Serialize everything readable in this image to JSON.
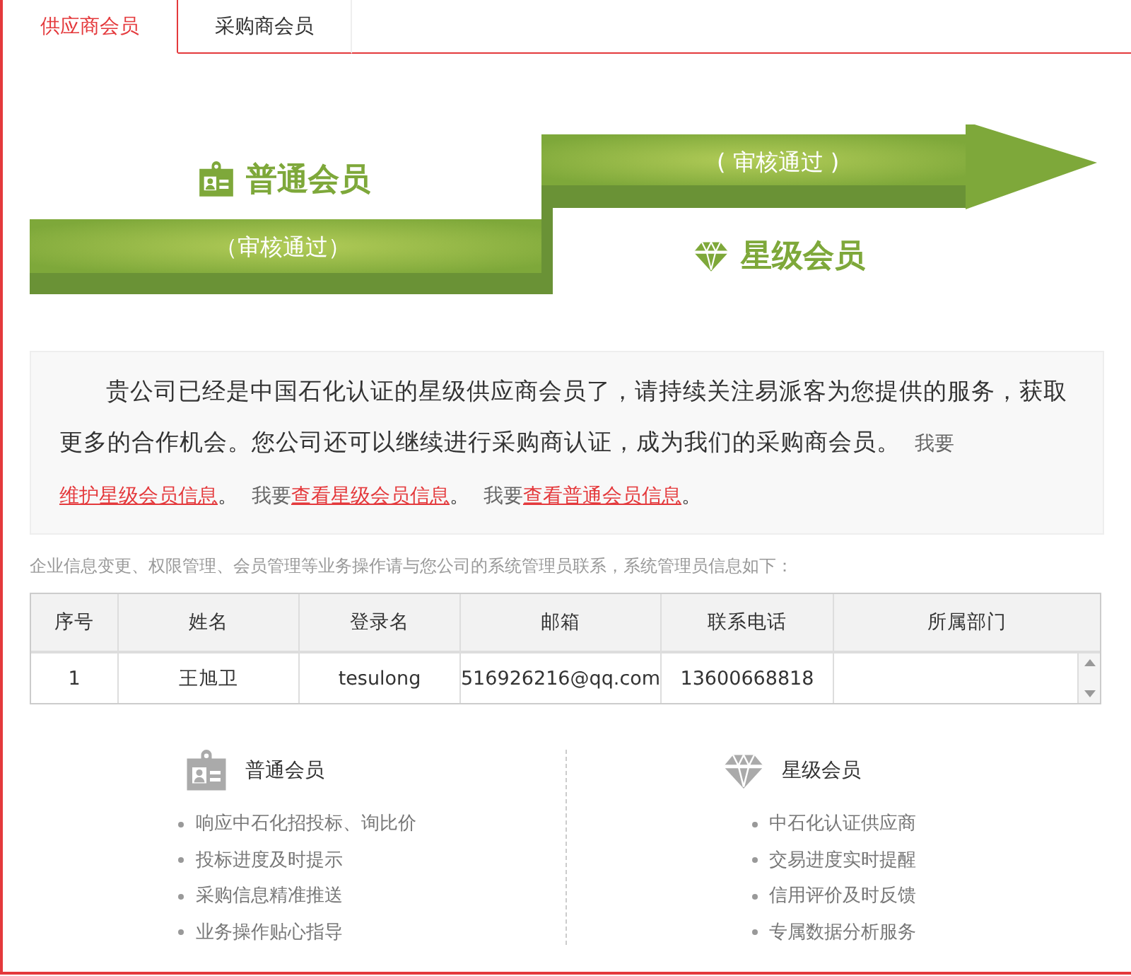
{
  "tabs": [
    {
      "label": "供应商会员",
      "selected": true
    },
    {
      "label": "采购商会员",
      "selected": false
    }
  ],
  "progress": {
    "basic": {
      "title": "普通会员",
      "status": "（审核通过）"
    },
    "star": {
      "title": "星级会员",
      "status": "( 审核通过 )"
    }
  },
  "info": {
    "segments": [
      {
        "kind": "text",
        "text": "贵公司已经是中国石化认证的星级供应商会员了，请持续关注易派客为您提供的服务，获取更多的合作机会。您公司还可以继续进行采购商认证，成为我们的采购商会员。"
      },
      {
        "kind": "prompt",
        "text": "我要"
      },
      {
        "kind": "link",
        "text": "维护星级会员信息"
      },
      {
        "kind": "text",
        "text": "。"
      },
      {
        "kind": "prompt",
        "text": "我要"
      },
      {
        "kind": "link",
        "text": "查看星级会员信息"
      },
      {
        "kind": "text",
        "text": "。"
      },
      {
        "kind": "prompt",
        "text": "我要"
      },
      {
        "kind": "link",
        "text": "查看普通会员信息"
      },
      {
        "kind": "text",
        "text": "。"
      }
    ]
  },
  "admin_note": "企业信息变更、权限管理、会员管理等业务操作请与您公司的系统管理员联系，系统管理员信息如下：",
  "table": {
    "columns": [
      "序号",
      "姓名",
      "登录名",
      "邮箱",
      "联系电话",
      "所属部门"
    ],
    "rows": [
      [
        "1",
        "王旭卫",
        "tesulong",
        "516926216@qq.com",
        "13600668818"
      ]
    ]
  },
  "benefits": [
    {
      "kind": "basic",
      "title": "普通会员",
      "items": [
        "响应中石化招投标、询比价",
        "投标进度及时提示",
        "采购信息精准推送",
        "业务操作贴心指导"
      ]
    },
    {
      "kind": "star",
      "title": "星级会员",
      "items": [
        "中石化认证供应商",
        "交易进度实时提醒",
        "信用评价及时反馈",
        "专属数据分析服务"
      ]
    }
  ]
}
